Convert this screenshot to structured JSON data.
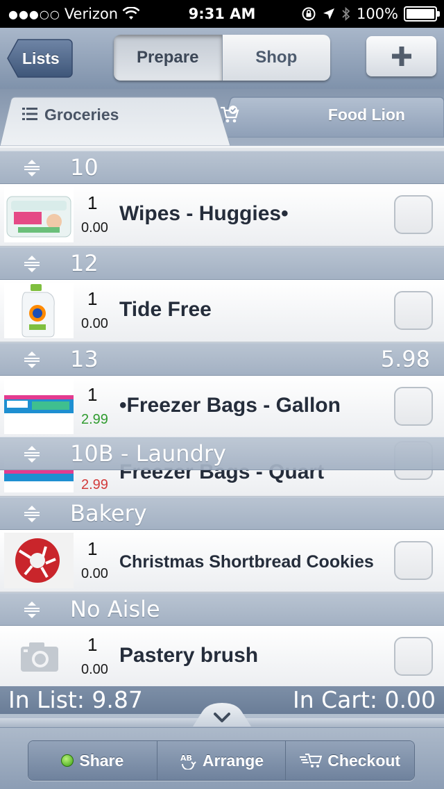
{
  "status_bar": {
    "signal": "●●●○○",
    "carrier": "Verizon",
    "time": "9:31 AM",
    "battery": "100%"
  },
  "nav": {
    "back_label": "Lists",
    "segments": [
      "Prepare",
      "Shop"
    ],
    "selected_segment": "Prepare",
    "add_icon": "plus-icon"
  },
  "tabs": {
    "list_name": "Groceries",
    "store_name": "Food Lion"
  },
  "sections": [
    {
      "name": "10",
      "total": ""
    },
    {
      "name": "12",
      "total": ""
    },
    {
      "name": "13",
      "total": "5.98"
    },
    {
      "name": "10B - Laundry",
      "total": ""
    },
    {
      "name": "Bakery",
      "total": ""
    },
    {
      "name": "No Aisle",
      "total": ""
    }
  ],
  "items": [
    {
      "qty": "1",
      "price": "0.00",
      "name": "Wipes - Huggies•",
      "image": "wipes-image"
    },
    {
      "qty": "1",
      "price": "0.00",
      "name": "Tide Free",
      "image": "detergent-image"
    },
    {
      "qty": "1",
      "price": "2.99",
      "name": "•Freezer Bags - Gallon",
      "image": "freezer-bags-image"
    },
    {
      "qty": "",
      "price": "2.99",
      "name": "Freezer Bags - Quart",
      "image": "freezer-bags-image"
    },
    {
      "qty": "1",
      "price": "0.00",
      "name": "Christmas Shortbread Cookies",
      "image": "cookies-image"
    },
    {
      "qty": "1",
      "price": "0.00",
      "name": "Pastery brush",
      "image": "camera-placeholder-icon"
    }
  ],
  "summary": {
    "in_list": "In List: 9.87",
    "in_cart": "In Cart: 0.00"
  },
  "toolbar": {
    "share": "Share",
    "arrange": "Arrange",
    "checkout": "Checkout"
  },
  "colors": {
    "section_bar": "#a3b1c3",
    "nav_bar": "#7f92ab",
    "price_green": "#2f9b2f",
    "price_red": "#d23a3a"
  }
}
